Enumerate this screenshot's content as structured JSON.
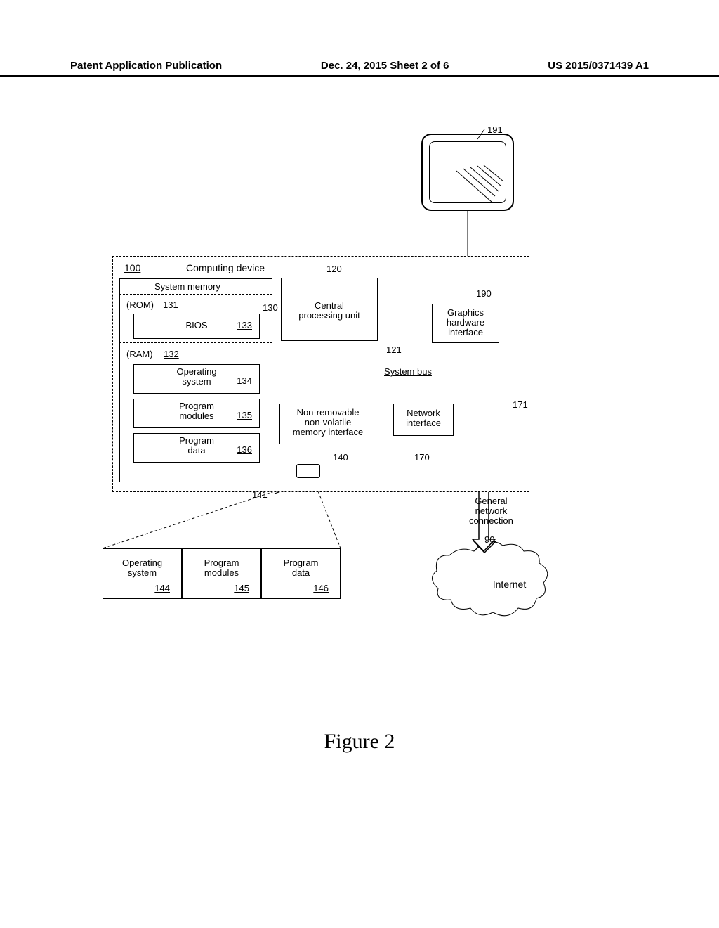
{
  "header": {
    "left": "Patent Application Publication",
    "center": "Dec. 24, 2015  Sheet 2 of 6",
    "right": "US 2015/0371439 A1"
  },
  "figure_label": "Figure 2",
  "computing_device": {
    "ref_num": "100",
    "title": "Computing device"
  },
  "system_memory": {
    "title": "System memory",
    "rom": {
      "label": "(ROM)",
      "num": "131"
    },
    "bios": {
      "label": "BIOS",
      "num": "133"
    },
    "ram": {
      "label": "(RAM)",
      "num": "132"
    },
    "os": {
      "label": "Operating\nsystem",
      "num": "134"
    },
    "pm": {
      "label": "Program\nmodules",
      "num": "135"
    },
    "pd": {
      "label": "Program\ndata",
      "num": "136"
    }
  },
  "refs": {
    "r130": "130",
    "r120": "120",
    "r121": "121",
    "r190": "190",
    "r191": "191",
    "r140": "140",
    "r141": "141",
    "r170": "170",
    "r171": "171",
    "r90": "90"
  },
  "cpu": "Central\nprocessing unit",
  "graphics": "Graphics\nhardware\ninterface",
  "sysbus": "System bus",
  "nonremov": "Non-removable\nnon-volatile\nmemory interface",
  "netif": "Network\ninterface",
  "gnc": "General\nnetwork\nconnection",
  "internet": "Internet",
  "disk": {
    "os": {
      "label": "Operating\nsystem",
      "num": "144"
    },
    "pm": {
      "label": "Program\nmodules",
      "num": "145"
    },
    "pd": {
      "label": "Program\ndata",
      "num": "146"
    }
  }
}
